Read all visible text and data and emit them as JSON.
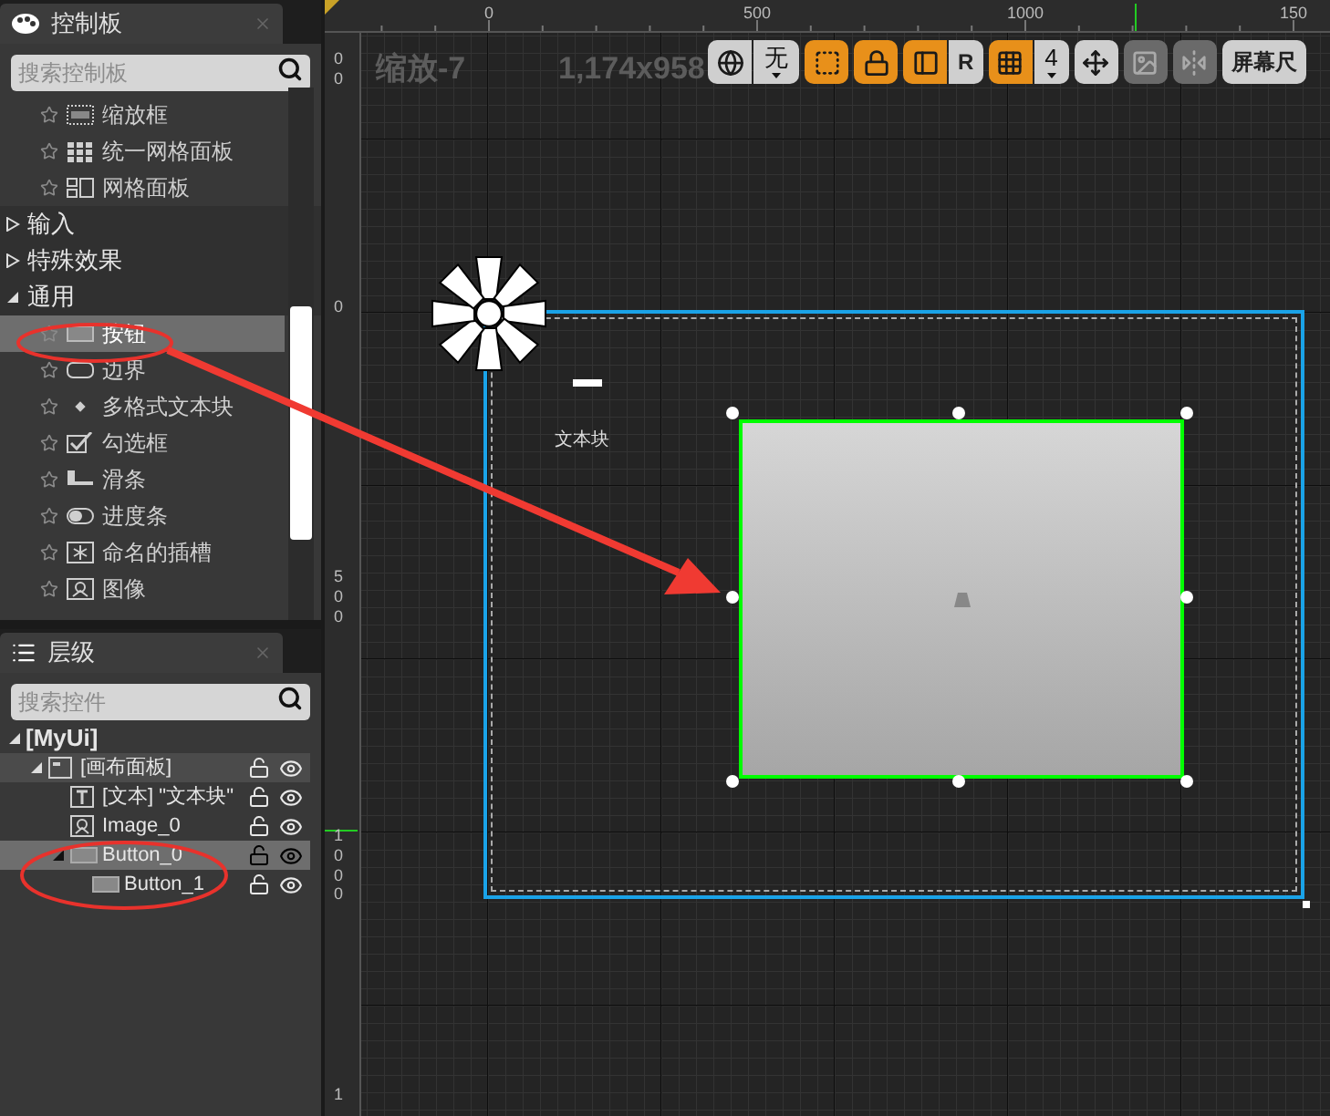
{
  "palette": {
    "tab": "控制板",
    "search_placeholder": "搜索控制板",
    "entries": [
      {
        "kind": "scalebox",
        "label": "缩放框",
        "selected": false
      },
      {
        "kind": "uniformgrid",
        "label": "统一网格面板",
        "selected": false
      },
      {
        "kind": "grid",
        "label": "网格面板",
        "selected": false
      },
      {
        "kind": "category",
        "label": "输入",
        "expanded": false
      },
      {
        "kind": "category",
        "label": "特殊效果",
        "expanded": false
      },
      {
        "kind": "category",
        "label": "通用",
        "expanded": true,
        "children": [
          {
            "kind": "button",
            "label": "按钮",
            "selected": true
          },
          {
            "kind": "border",
            "label": "边界",
            "selected": false
          },
          {
            "kind": "richtext",
            "label": "多格式文本块",
            "selected": false
          },
          {
            "kind": "checkbox",
            "label": "勾选框",
            "selected": false
          },
          {
            "kind": "slider",
            "label": "滑条",
            "selected": false
          },
          {
            "kind": "progress",
            "label": "进度条",
            "selected": false
          },
          {
            "kind": "namedslot",
            "label": "命名的插槽",
            "selected": false
          },
          {
            "kind": "image",
            "label": "图像",
            "selected": false
          }
        ]
      }
    ]
  },
  "hierarchy": {
    "tab": "层级",
    "search_placeholder": "搜索控件",
    "nodes": [
      {
        "kind": "root",
        "label": "[MyUi]",
        "expanded": true,
        "selected": false,
        "hovered": false,
        "children": [
          {
            "kind": "canvas",
            "label": "[画布面板]",
            "expanded": true,
            "selected": false,
            "hovered": true,
            "children": [
              {
                "kind": "text",
                "label": "[文本] \"文本块\"",
                "selected": false,
                "hovered": false
              },
              {
                "kind": "image",
                "label": "Image_0",
                "selected": false,
                "hovered": false
              },
              {
                "kind": "button",
                "label": "Button_0",
                "expanded": true,
                "selected": true,
                "hovered": false,
                "children": [
                  {
                    "kind": "button",
                    "label": "Button_1",
                    "selected": false,
                    "hovered": false
                  }
                ]
              }
            ]
          }
        ]
      }
    ]
  },
  "designer": {
    "zoom_label": "缩放-7",
    "resolution": "1,174x958",
    "top_ruler": [
      "0",
      "500",
      "1000",
      "150"
    ],
    "left_ruler": [
      "00",
      "0",
      "500",
      "1000",
      "1"
    ],
    "text_block": "文本块",
    "toolbar": [
      [
        {
          "kind": "globe",
          "on": false,
          "disabled": false
        },
        {
          "kind": "dropdown",
          "label": "无"
        }
      ],
      [
        {
          "kind": "outline",
          "on": true,
          "disabled": false
        }
      ],
      [
        {
          "kind": "lock",
          "on": true,
          "disabled": false
        }
      ],
      [
        {
          "kind": "layout",
          "on": true,
          "disabled": false
        },
        {
          "kind": "text",
          "label": "R",
          "on": false,
          "disabled": false
        }
      ],
      [
        {
          "kind": "grid",
          "on": true,
          "disabled": false
        },
        {
          "kind": "dropdown",
          "label": "4"
        }
      ],
      [
        {
          "kind": "transform",
          "on": false,
          "disabled": false
        }
      ],
      [
        {
          "kind": "image",
          "disabled": true
        }
      ],
      [
        {
          "kind": "mirror",
          "disabled": true
        }
      ],
      [
        {
          "kind": "label",
          "label": "屏幕尺",
          "on": false,
          "disabled": false
        }
      ]
    ]
  }
}
